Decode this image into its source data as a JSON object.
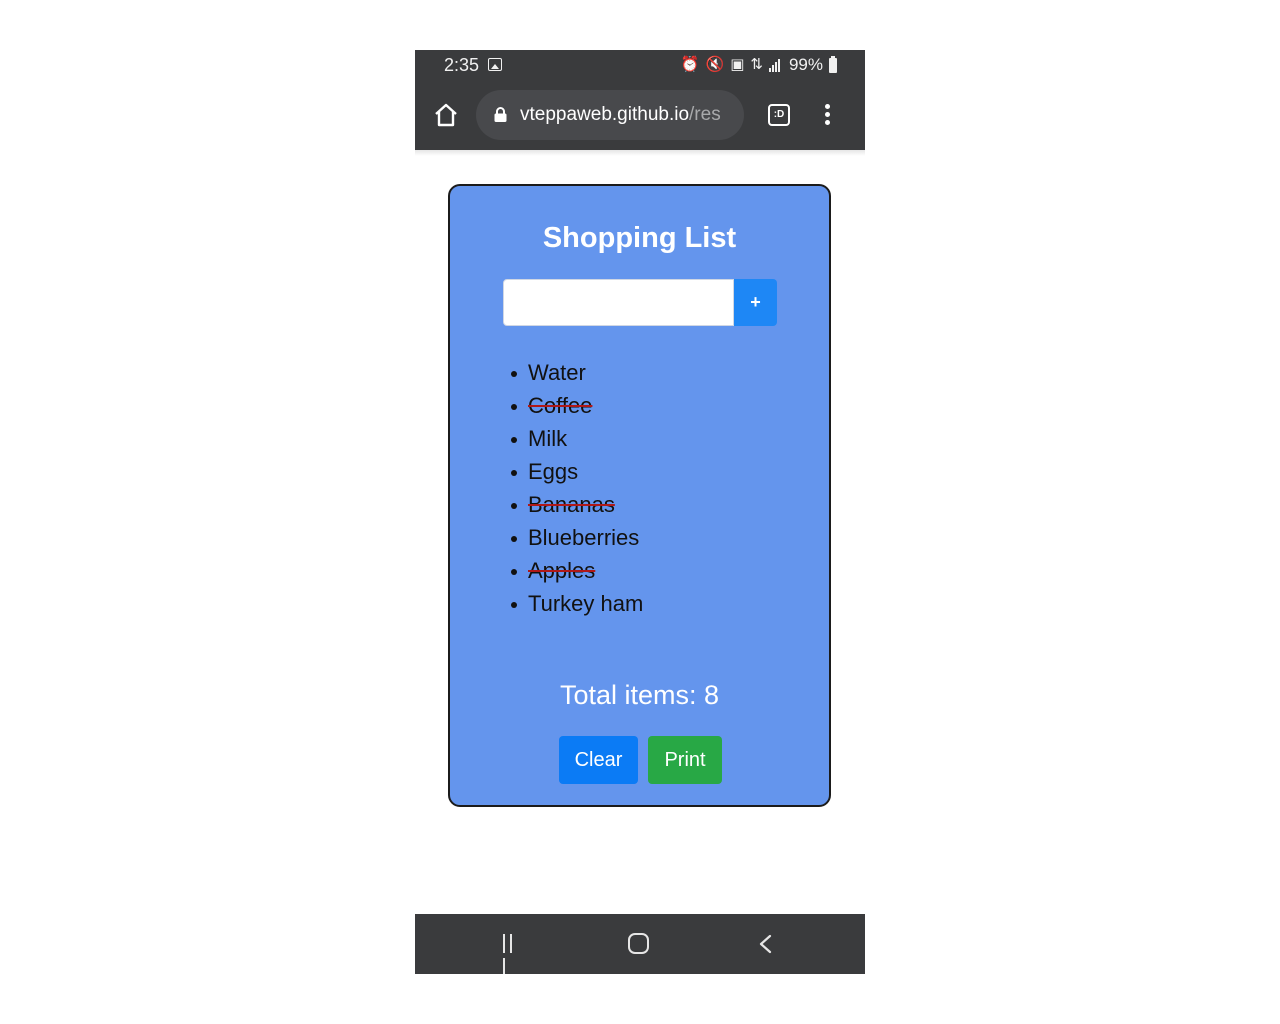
{
  "status_bar": {
    "time": "2:35",
    "battery": "99%",
    "icons": [
      "image-icon",
      "alarm-icon",
      "mute-vibrate-icon",
      "sim-lock-icon",
      "data-transfer-icon",
      "signal-icon",
      "battery-icon"
    ]
  },
  "browser": {
    "url_domain": "vteppaweb.github.io",
    "url_path": "/res",
    "tab_switch_label": ":D",
    "icons": [
      "home-icon",
      "lock-icon",
      "tab-switcher-icon",
      "more-menu-icon"
    ]
  },
  "app": {
    "title": "Shopping List",
    "input": {
      "value": "",
      "placeholder": ""
    },
    "add_button_label": "+",
    "items": [
      {
        "label": "Water",
        "done": false
      },
      {
        "label": "Coffee",
        "done": true
      },
      {
        "label": "Milk",
        "done": false
      },
      {
        "label": "Eggs",
        "done": false
      },
      {
        "label": "Bananas",
        "done": true
      },
      {
        "label": "Blueberries",
        "done": false
      },
      {
        "label": "Apples",
        "done": true
      },
      {
        "label": "Turkey ham",
        "done": false
      }
    ],
    "total_label": "Total items: 8",
    "clear_button_label": "Clear",
    "print_button_label": "Print",
    "colors": {
      "card_background": "#6495ed",
      "add_button": "#1e87f5",
      "clear_button": "#0b7bf5",
      "print_button": "#28a845",
      "strike_through": "#b01818"
    }
  },
  "nav_bar": {
    "icons": [
      "recents-icon",
      "home-circle-icon",
      "back-icon"
    ]
  }
}
